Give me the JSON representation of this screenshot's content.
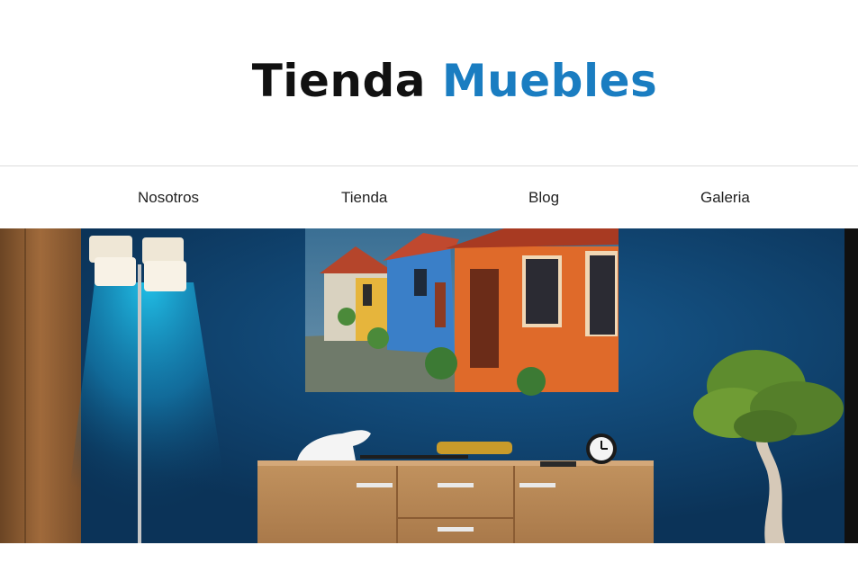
{
  "site": {
    "title_part1": "Tienda",
    "title_part2": "Muebles"
  },
  "nav": {
    "items": [
      {
        "label": "Nosotros"
      },
      {
        "label": "Tienda"
      },
      {
        "label": "Blog"
      },
      {
        "label": "Galeria"
      }
    ]
  },
  "hero": {
    "image_icon": "living-room-photo",
    "colors": {
      "wall": "#0e3f6c",
      "wood": "#b58455",
      "accent": "#1a7dc1"
    }
  }
}
